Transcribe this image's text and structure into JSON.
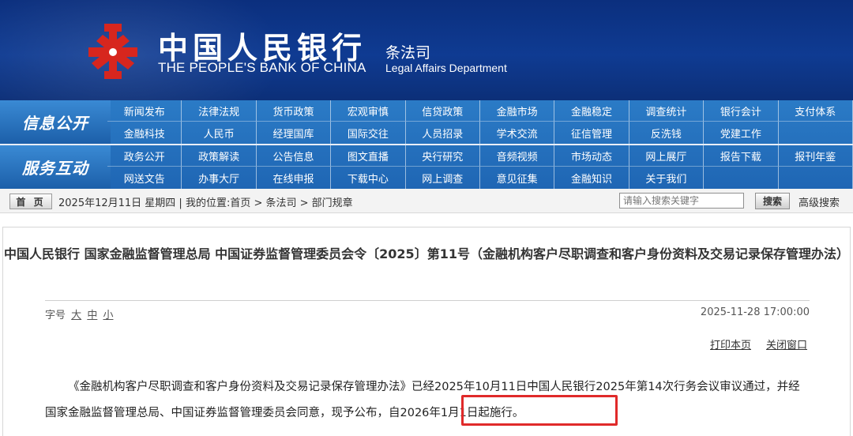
{
  "header": {
    "bank_name_cn": "中国人民银行",
    "bank_name_en": "THE PEOPLE'S BANK OF CHINA",
    "dept_cn": "条法司",
    "dept_en": "Legal Affairs Department",
    "logo_icon": "pboc-logo-icon",
    "logo_color": "#d7261e",
    "bg_color": "#0f3b92"
  },
  "nav": {
    "info_label": "信息公开",
    "service_label": "服务互动",
    "info_row1": [
      "新闻发布",
      "法律法规",
      "货币政策",
      "宏观审慎",
      "信贷政策",
      "金融市场",
      "金融稳定",
      "调查统计",
      "银行会计",
      "支付体系"
    ],
    "info_row2": [
      "金融科技",
      "人民币",
      "经理国库",
      "国际交往",
      "人员招录",
      "学术交流",
      "征信管理",
      "反洗钱",
      "党建工作",
      ""
    ],
    "service_row1": [
      "政务公开",
      "政策解读",
      "公告信息",
      "图文直播",
      "央行研究",
      "音频视频",
      "市场动态",
      "网上展厅",
      "报告下载",
      "报刊年鉴"
    ],
    "service_row2": [
      "网送文告",
      "办事大厅",
      "在线申报",
      "下载中心",
      "网上调查",
      "意见征集",
      "金融知识",
      "关于我们",
      "",
      ""
    ]
  },
  "breadcrumb": {
    "home_label": "首 页",
    "text": "2025年12月11日 星期四 | 我的位置:首页 > 条法司 > 部门规章",
    "search_placeholder": "请输入搜索关键字",
    "search_button": "搜索",
    "advanced_search": "高级搜索"
  },
  "article": {
    "title": "中国人民银行 国家金融监督管理总局 中国证券监督管理委员会令〔2025〕第11号（金融机构客户尽职调查和客户身份资料及交易记录保存管理办法）",
    "font_size_label": "字号",
    "font_sizes": [
      "大",
      "中",
      "小"
    ],
    "date": "2025-11-28 17:00:00",
    "print_label": "打印本页",
    "close_label": "关闭窗口",
    "body": "《金融机构客户尽职调查和客户身份资料及交易记录保存管理办法》已经2025年10月11日中国人民银行2025年第14次行务会议审议通过，并经国家金融监督管理总局、中国证券监督管理委员会同意，现予公布，自2026年1月1日起施行。",
    "highlight_color": "#e02a2a"
  }
}
